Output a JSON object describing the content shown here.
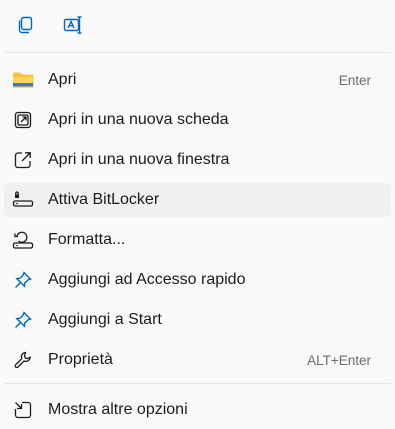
{
  "toolbar": {
    "buttons": [
      {
        "icon": "copy-icon"
      },
      {
        "icon": "rename-icon"
      }
    ]
  },
  "items": [
    {
      "label": "Apri",
      "shortcut": "Enter",
      "icon": "folder-icon"
    },
    {
      "label": "Apri in una nuova scheda",
      "shortcut": "",
      "icon": "open-new-tab-icon"
    },
    {
      "label": "Apri in una nuova finestra",
      "shortcut": "",
      "icon": "open-new-window-icon"
    },
    {
      "label": "Attiva BitLocker",
      "shortcut": "",
      "icon": "bitlocker-key-icon"
    },
    {
      "label": "Formatta...",
      "shortcut": "",
      "icon": "format-drive-icon"
    },
    {
      "label": "Aggiungi ad Accesso rapido",
      "shortcut": "",
      "icon": "pin-icon"
    },
    {
      "label": "Aggiungi a Start",
      "shortcut": "",
      "icon": "pin-icon"
    },
    {
      "label": "Proprietà",
      "shortcut": "ALT+Enter",
      "icon": "wrench-icon"
    },
    {
      "label": "Mostra altre opzioni",
      "shortcut": "",
      "icon": "more-options-icon"
    }
  ],
  "colors": {
    "accent": "#0067c0",
    "folder": "#f6c343",
    "hover": "#f0f0f0",
    "background": "#f9f9f9"
  }
}
